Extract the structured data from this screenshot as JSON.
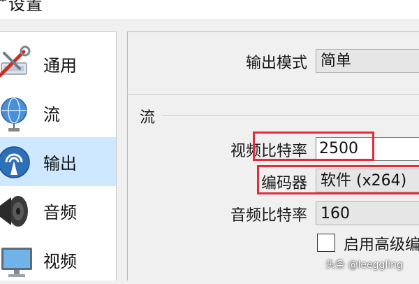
{
  "window": {
    "title": "设置",
    "title_glyph": "⚙"
  },
  "sidebar": {
    "items": [
      {
        "label": "通用",
        "icon": "general-settings-icon"
      },
      {
        "label": "流",
        "icon": "stream-globe-icon"
      },
      {
        "label": "输出",
        "icon": "output-broadcast-icon",
        "selected": true
      },
      {
        "label": "音频",
        "icon": "speaker-icon"
      },
      {
        "label": "视频",
        "icon": "monitor-icon"
      }
    ],
    "selected_color": "#cde8ff"
  },
  "output": {
    "mode_label": "输出模式",
    "mode_value": "简单",
    "section_title": "流",
    "video_bitrate_label": "视频比特率",
    "video_bitrate_value": "2500",
    "encoder_label": "编码器",
    "encoder_value": "软件 (x264)",
    "audio_bitrate_label": "音频比特率",
    "audio_bitrate_value": "160",
    "advanced_checkbox_label": "启用高级编",
    "advanced_checked": false
  },
  "highlight_color": "#e22c3a",
  "watermark": "头条 @leeggling"
}
